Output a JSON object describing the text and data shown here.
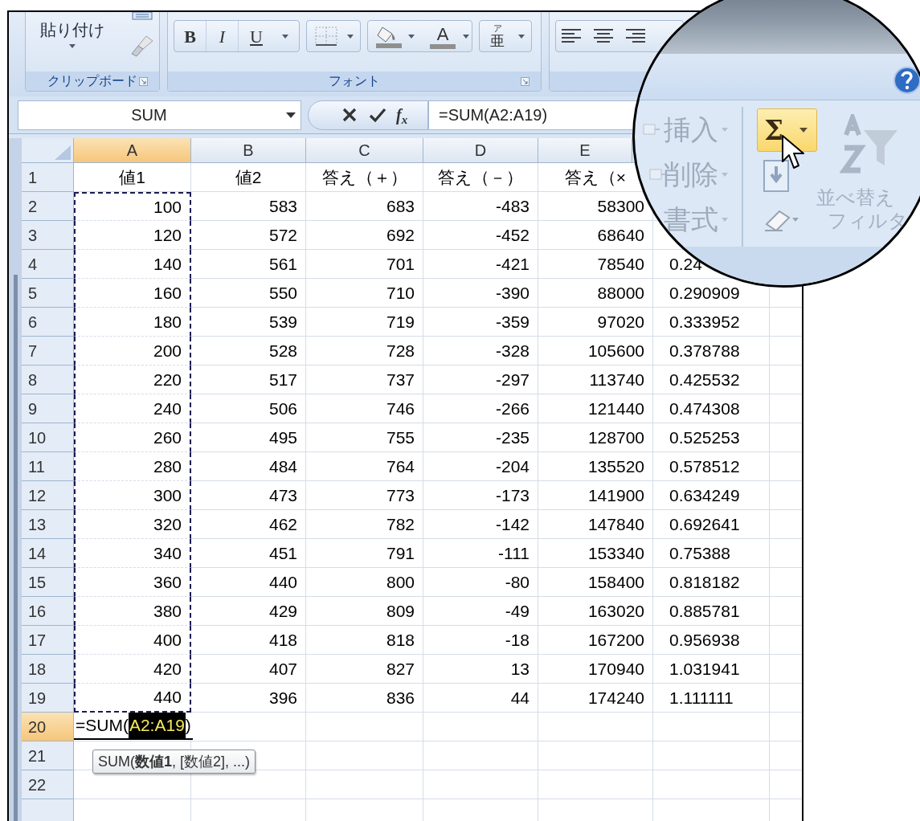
{
  "ribbon": {
    "clipboard": {
      "paste": "貼り付け",
      "label": "クリップボード"
    },
    "font": {
      "bold": "B",
      "italic": "I",
      "underline": "U",
      "font_color": "A",
      "phonetic_ruby": "ア",
      "phonetic_base": "亜",
      "label": "フォント"
    }
  },
  "formula_bar": {
    "name_box": "SUM",
    "function_symbol": "f$_{x}$",
    "formula": "=SUM(A2:A19)"
  },
  "columns": [
    {
      "label": "A",
      "selected": true
    },
    {
      "label": "B",
      "selected": false
    },
    {
      "label": "C",
      "selected": false
    },
    {
      "label": "D",
      "selected": false
    },
    {
      "label": "E",
      "selected": false
    }
  ],
  "rows": [
    {
      "number": "1",
      "kind": "header",
      "selected": false,
      "referenced": false,
      "cells": [
        "値1",
        "値2",
        "答え（＋）",
        "答え（－）",
        "答え（×"
      ]
    },
    {
      "number": "2",
      "kind": "data",
      "selected": false,
      "referenced": true,
      "cells": [
        "100",
        "583",
        "683",
        "-483",
        "58300"
      ]
    },
    {
      "number": "3",
      "kind": "data",
      "selected": false,
      "referenced": true,
      "cells": [
        "120",
        "572",
        "692",
        "-452",
        "68640"
      ]
    },
    {
      "number": "4",
      "kind": "data",
      "selected": false,
      "referenced": true,
      "cells": [
        "140",
        "561",
        "701",
        "-421",
        "78540",
        "0.24"
      ]
    },
    {
      "number": "5",
      "kind": "data",
      "selected": false,
      "referenced": true,
      "cells": [
        "160",
        "550",
        "710",
        "-390",
        "88000",
        "0.290909"
      ]
    },
    {
      "number": "6",
      "kind": "data",
      "selected": false,
      "referenced": true,
      "cells": [
        "180",
        "539",
        "719",
        "-359",
        "97020",
        "0.333952"
      ]
    },
    {
      "number": "7",
      "kind": "data",
      "selected": false,
      "referenced": true,
      "cells": [
        "200",
        "528",
        "728",
        "-328",
        "105600",
        "0.378788"
      ]
    },
    {
      "number": "8",
      "kind": "data",
      "selected": false,
      "referenced": true,
      "cells": [
        "220",
        "517",
        "737",
        "-297",
        "113740",
        "0.425532"
      ]
    },
    {
      "number": "9",
      "kind": "data",
      "selected": false,
      "referenced": true,
      "cells": [
        "240",
        "506",
        "746",
        "-266",
        "121440",
        "0.474308"
      ]
    },
    {
      "number": "10",
      "kind": "data",
      "selected": false,
      "referenced": true,
      "cells": [
        "260",
        "495",
        "755",
        "-235",
        "128700",
        "0.525253"
      ]
    },
    {
      "number": "11",
      "kind": "data",
      "selected": false,
      "referenced": true,
      "cells": [
        "280",
        "484",
        "764",
        "-204",
        "135520",
        "0.578512"
      ]
    },
    {
      "number": "12",
      "kind": "data",
      "selected": false,
      "referenced": true,
      "cells": [
        "300",
        "473",
        "773",
        "-173",
        "141900",
        "0.634249"
      ]
    },
    {
      "number": "13",
      "kind": "data",
      "selected": false,
      "referenced": true,
      "cells": [
        "320",
        "462",
        "782",
        "-142",
        "147840",
        "0.692641"
      ]
    },
    {
      "number": "14",
      "kind": "data",
      "selected": false,
      "referenced": true,
      "cells": [
        "340",
        "451",
        "791",
        "-111",
        "153340",
        "0.75388"
      ]
    },
    {
      "number": "15",
      "kind": "data",
      "selected": false,
      "referenced": true,
      "cells": [
        "360",
        "440",
        "800",
        "-80",
        "158400",
        "0.818182"
      ]
    },
    {
      "number": "16",
      "kind": "data",
      "selected": false,
      "referenced": true,
      "cells": [
        "380",
        "429",
        "809",
        "-49",
        "163020",
        "0.885781"
      ]
    },
    {
      "number": "17",
      "kind": "data",
      "selected": false,
      "referenced": true,
      "cells": [
        "400",
        "418",
        "818",
        "-18",
        "167200",
        "0.956938"
      ]
    },
    {
      "number": "18",
      "kind": "data",
      "selected": false,
      "referenced": true,
      "cells": [
        "420",
        "407",
        "827",
        "13",
        "170940",
        "1.031941"
      ]
    },
    {
      "number": "19",
      "kind": "data",
      "selected": false,
      "referenced": true,
      "cells": [
        "440",
        "396",
        "836",
        "44",
        "174240",
        "1.111111"
      ]
    },
    {
      "number": "20",
      "selected": true,
      "referenced": false,
      "editor": {
        "before": "=SUM(",
        "reference": "A2:A19",
        "after": ")",
        "hint": "SUM(**数値1**, [数値2], ...)"
      }
    },
    {
      "number": "21",
      "selected": false,
      "referenced": false
    },
    {
      "number": "22",
      "selected": false,
      "referenced": false
    }
  ],
  "magnifier": {
    "commands": [
      {
        "label": "挿入",
        "disabled": true
      },
      {
        "label": "削除",
        "disabled": true
      },
      {
        "label": "書式",
        "disabled": true
      }
    ],
    "autosum": {
      "symbol": "Σ",
      "selected": true
    },
    "sort_filter": [
      "並べ替え",
      "フィルタ"
    ]
  }
}
